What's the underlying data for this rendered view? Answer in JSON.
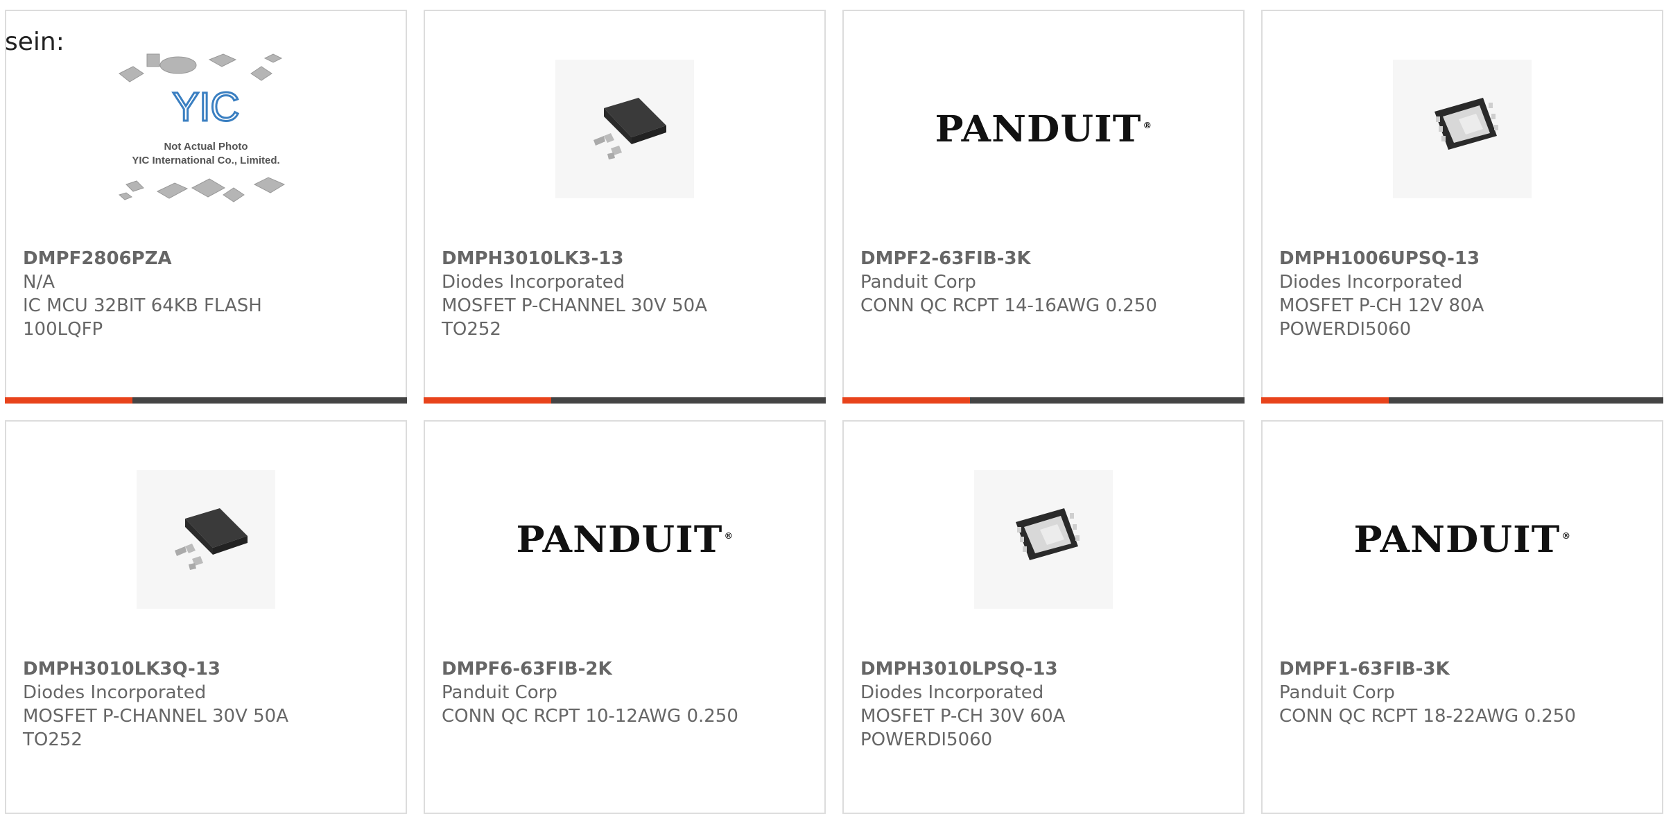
{
  "header": {
    "sein_label": "sein:"
  },
  "colors": {
    "accent": "#e8431b",
    "bar": "#444444",
    "text": "#666666",
    "border": "#dcdcdc"
  },
  "placeholder_image": {
    "line1": "Not Actual Photo",
    "line2": "YIC International Co., Limited.",
    "logo": "YIC"
  },
  "panduit_logo": {
    "text": "PANDUIT"
  },
  "products": [
    {
      "part_number": "DMPF2806PZA",
      "manufacturer": "N/A",
      "desc1": "IC MCU 32BIT 64KB FLASH",
      "desc2": "100LQFP",
      "image": "placeholder-photo"
    },
    {
      "part_number": "DMPH3010LK3-13",
      "manufacturer": "Diodes Incorporated",
      "desc1": "MOSFET P-CHANNEL 30V 50A",
      "desc2": "TO252",
      "image": "to252-package"
    },
    {
      "part_number": "DMPF2-63FIB-3K",
      "manufacturer": "Panduit Corp",
      "desc1": "CONN QC RCPT 14-16AWG 0.250",
      "desc2": "",
      "image": "panduit-logo"
    },
    {
      "part_number": "DMPH1006UPSQ-13",
      "manufacturer": "Diodes Incorporated",
      "desc1": "MOSFET P-CH 12V 80A",
      "desc2": "POWERDI5060",
      "image": "powerdi-package"
    },
    {
      "part_number": "DMPH3010LK3Q-13",
      "manufacturer": "Diodes Incorporated",
      "desc1": "MOSFET P-CHANNEL 30V 50A",
      "desc2": "TO252",
      "image": "to252-package"
    },
    {
      "part_number": "DMPF6-63FIB-2K",
      "manufacturer": "Panduit Corp",
      "desc1": "CONN QC RCPT 10-12AWG 0.250",
      "desc2": "",
      "image": "panduit-logo"
    },
    {
      "part_number": "DMPH3010LPSQ-13",
      "manufacturer": "Diodes Incorporated",
      "desc1": "MOSFET P-CH 30V 60A",
      "desc2": "POWERDI5060",
      "image": "powerdi-package"
    },
    {
      "part_number": "DMPF1-63FIB-3K",
      "manufacturer": "Panduit Corp",
      "desc1": "CONN QC RCPT 18-22AWG 0.250",
      "desc2": "",
      "image": "panduit-logo"
    }
  ]
}
